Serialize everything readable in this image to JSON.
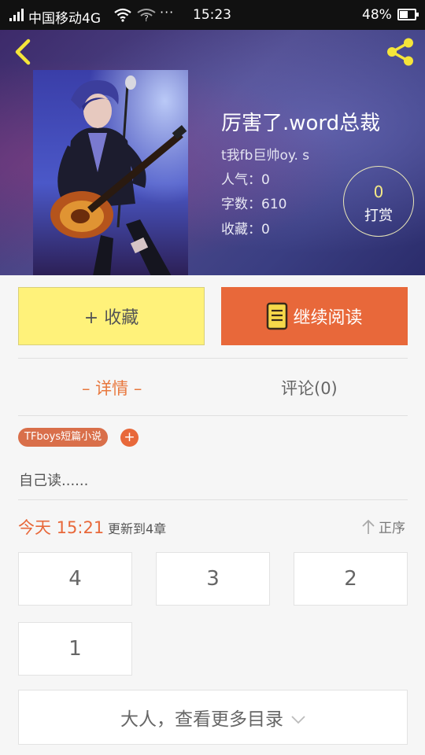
{
  "status_bar": {
    "carrier": "中国移动4G",
    "wifi2_label": "?",
    "more_dots": "···",
    "time": "15:23",
    "battery": "48%"
  },
  "book": {
    "title": "厉害了.word总裁",
    "author": "t我fb巨帅oy. s",
    "popularity": "人气：0",
    "word_count": "字数：610",
    "favorites": "收藏：0"
  },
  "tip": {
    "count": "0",
    "label": "打赏"
  },
  "actions": {
    "favorite": "+ 收藏",
    "continue_reading": "继续阅读"
  },
  "tabs": {
    "detail": "– 详情 –",
    "comments": "评论(0)"
  },
  "tag": {
    "label": "TFboys短篇小说",
    "add": "+"
  },
  "description": "自己读......",
  "update": {
    "date": "今天 15:21",
    "text": "更新到4章",
    "sort": "正序"
  },
  "chapters": [
    "4",
    "3",
    "2",
    "1"
  ],
  "more_catalog": "大人，查看更多目录",
  "colors": {
    "accent": "#e8683a",
    "favorite_button": "#fff27a",
    "tip_number": "#f5ea86"
  }
}
